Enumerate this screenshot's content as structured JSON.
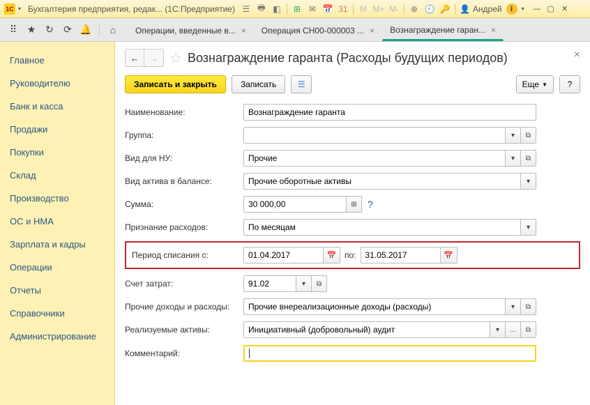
{
  "titlebar": {
    "logo_text": "1C",
    "title": "Бухгалтерия предприятия, редак...  (1С:Предприятие)",
    "user": "Андрей"
  },
  "tabs": [
    {
      "label": "Операции, введенные в..."
    },
    {
      "label": "Операция СН00-000003 ..."
    },
    {
      "label": "Вознаграждение гаран..."
    }
  ],
  "sidebar": {
    "items": [
      "Главное",
      "Руководителю",
      "Банк и касса",
      "Продажи",
      "Покупки",
      "Склад",
      "Производство",
      "ОС и НМА",
      "Зарплата и кадры",
      "Операции",
      "Отчеты",
      "Справочники",
      "Администрирование"
    ]
  },
  "document": {
    "title": "Вознаграждение гаранта (Расходы будущих периодов)"
  },
  "toolbar": {
    "save_close": "Записать и закрыть",
    "save": "Записать",
    "more": "Еще",
    "help": "?"
  },
  "form": {
    "name_label": "Наименование:",
    "name_value": "Вознаграждение гаранта",
    "group_label": "Группа:",
    "group_value": "",
    "nu_label": "Вид для НУ:",
    "nu_value": "Прочие",
    "asset_label": "Вид актива в балансе:",
    "asset_value": "Прочие оборотные активы",
    "sum_label": "Сумма:",
    "sum_value": "30 000,00",
    "recognition_label": "Признание расходов:",
    "recognition_value": "По месяцам",
    "period_label": "Период списания с:",
    "period_from": "01.04.2017",
    "period_to_label": "по:",
    "period_to": "31.05.2017",
    "account_label": "Счет затрат:",
    "account_value": "91.02",
    "income_label": "Прочие доходы и расходы:",
    "income_value": "Прочие внереализационные доходы (расходы)",
    "assets_label": "Реализуемые активы:",
    "assets_value": "Инициативный (добровольный) аудит",
    "comment_label": "Комментарий:",
    "comment_value": ""
  }
}
